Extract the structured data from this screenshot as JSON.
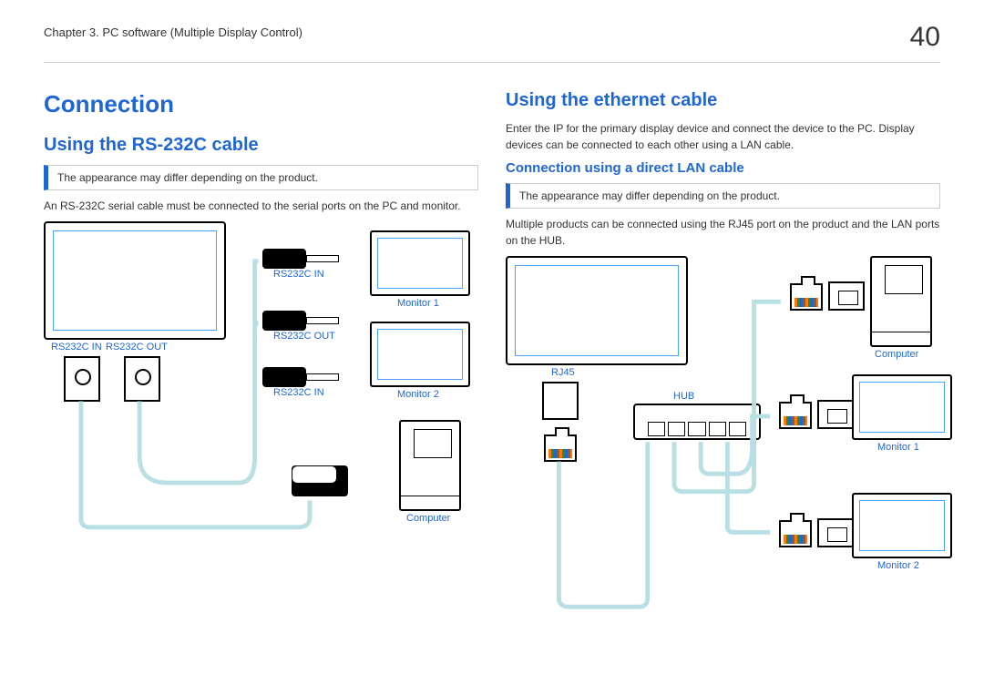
{
  "header": {
    "chapter": "Chapter 3. PC software (Multiple Display Control)",
    "page_number": "40"
  },
  "left": {
    "section_title": "Connection",
    "subsection": "Using the RS-232C cable",
    "note": "The appearance may differ depending on the product.",
    "body1": "An RS-232C serial cable must be connected to the serial ports on the PC and monitor.",
    "labels": {
      "rs232c_in_1": "RS232C IN",
      "rs232c_out_1": "RS232C OUT",
      "rs232c_in_top": "RS232C IN",
      "rs232c_out_mid": "RS232C OUT",
      "rs232c_in_bot": "RS232C IN",
      "monitor1": "Monitor 1",
      "monitor2": "Monitor 2",
      "computer": "Computer"
    }
  },
  "right": {
    "subsection": "Using the ethernet cable",
    "body1": "Enter the IP for the primary display device and connect the device to the PC. Display devices can be connected to each other using a LAN cable.",
    "subsub": "Connection using a direct LAN cable",
    "note": "The appearance may differ depending on the product.",
    "body2": "Multiple products can be connected using the RJ45 port on the product and the LAN ports on the HUB.",
    "labels": {
      "rj45": "RJ45",
      "hub": "HUB",
      "computer": "Computer",
      "monitor1": "Monitor 1",
      "monitor2": "Monitor 2"
    }
  }
}
